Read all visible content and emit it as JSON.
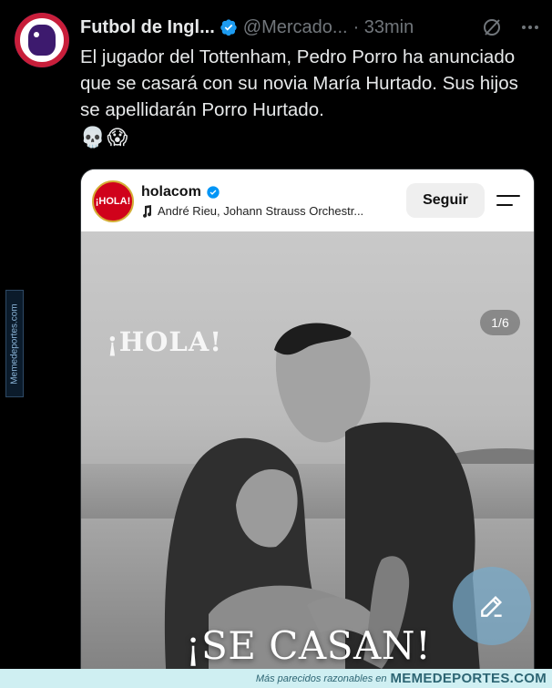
{
  "tweet": {
    "author_name": "Futbol de Ingl...",
    "handle": "@Mercado...",
    "time": "· 33min",
    "text": "El jugador del Tottenham, Pedro Porro ha anunciado que se casará con su novia María Hurtado. Sus hijos se apellidarán Porro Hurtado.",
    "emojis": "💀😱",
    "verified_color": "#1d9bf0"
  },
  "embed": {
    "logo_text": "¡HOLA!",
    "account": "holacom",
    "music": "André Rieu, Johann Strauss Orchestr...",
    "follow_label": "Seguir",
    "watermark": "¡HOLA!",
    "counter": "1/6",
    "headline": "¡SE CASAN!"
  },
  "side_watermark": "Memedeportes.com",
  "footer": {
    "tagline": "Más parecidos razonables en",
    "brand": "MEMEDEPORTES.COM"
  },
  "icons": [
    "premier-league-logo",
    "verified-badge-icon",
    "grok-icon",
    "more-icon",
    "music-note-icon",
    "hamburger-menu-icon",
    "compose-icon"
  ]
}
